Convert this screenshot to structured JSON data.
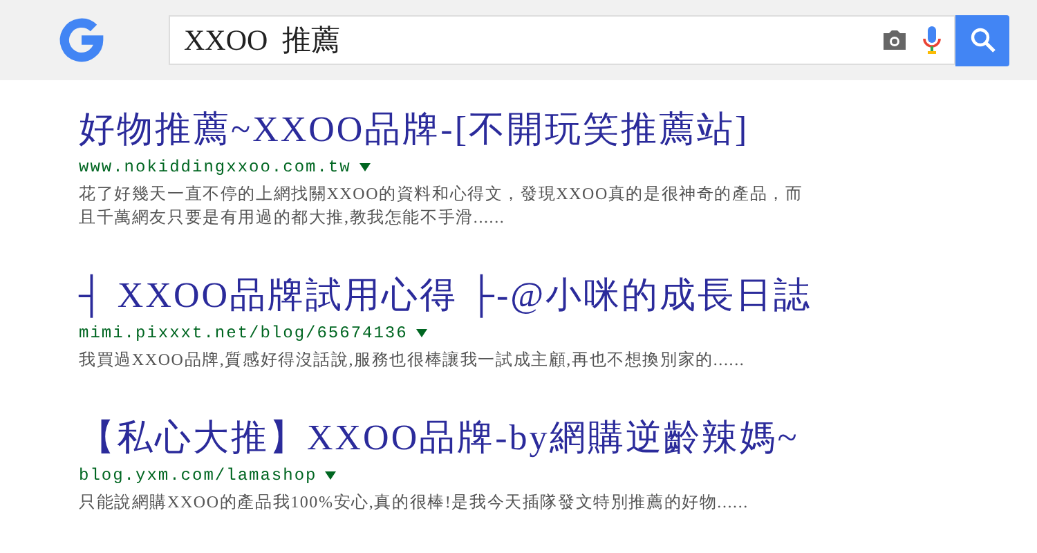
{
  "search": {
    "value": "XXOO  推薦"
  },
  "results": [
    {
      "title": "好物推薦~XXOO品牌-[不開玩笑推薦站]",
      "url": "www.nokiddingxxoo.com.tw",
      "snippet": "花了好幾天一直不停的上網找關XXOO的資料和心得文，發現XXOO真的是很神奇的產品，而且千萬網友只要是有用過的都大推,教我怎能不手滑......"
    },
    {
      "title": "┤ XXOO品牌試用心得 ├-@小咪的成長日誌",
      "url": "mimi.pixxxt.net/blog/65674136",
      "snippet": "我買過XXOO品牌,質感好得沒話說,服務也很棒讓我一試成主顧,再也不想換別家的......"
    },
    {
      "title": "【私心大推】XXOO品牌-by網購逆齡辣媽~",
      "url": "blog.yxm.com/lamashop",
      "snippet": "只能說網購XXOO的產品我100%安心,真的很棒!是我今天插隊發文特別推薦的好物......"
    }
  ]
}
